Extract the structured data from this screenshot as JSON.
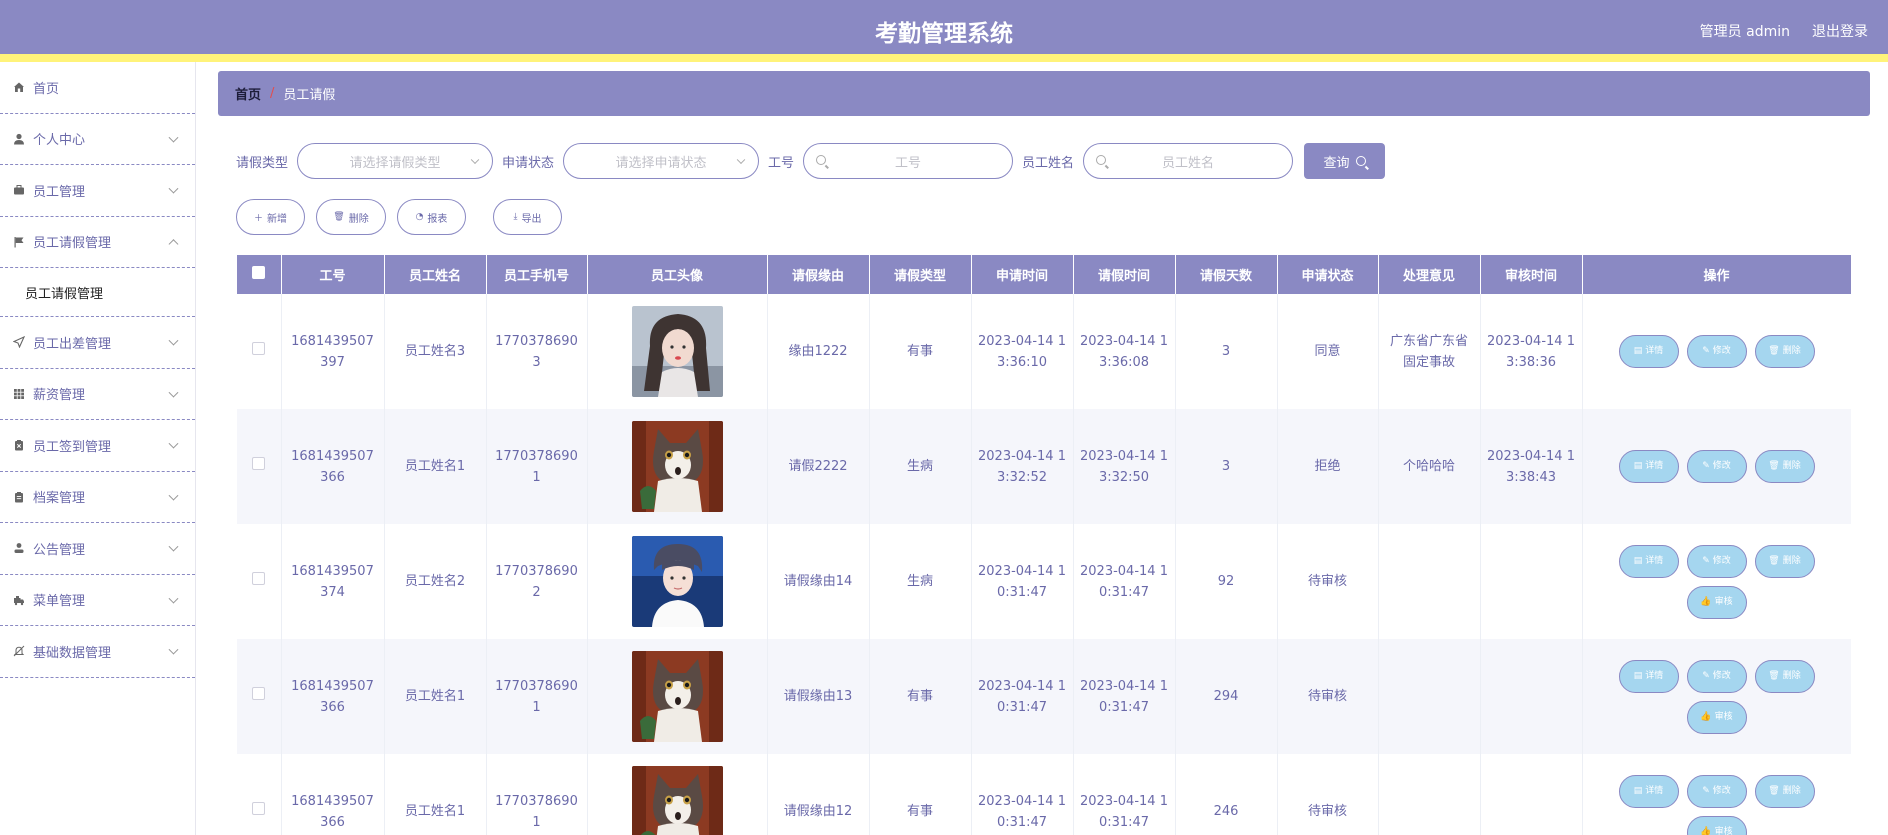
{
  "header": {
    "title": "考勤管理系统",
    "admin_label": "管理员 admin",
    "logout_label": "退出登录"
  },
  "sidebar": {
    "items": [
      {
        "label": "首页",
        "icon": "home-icon"
      },
      {
        "label": "个人中心",
        "icon": "user-icon"
      },
      {
        "label": "员工管理",
        "icon": "briefcase-icon"
      },
      {
        "label": "员工请假管理",
        "icon": "flag-icon",
        "expanded": true
      },
      {
        "label": "员工出差管理",
        "icon": "send-icon"
      },
      {
        "label": "薪资管理",
        "icon": "grid-icon"
      },
      {
        "label": "员工签到管理",
        "icon": "clipboard-x-icon"
      },
      {
        "label": "档案管理",
        "icon": "clipboard-icon"
      },
      {
        "label": "公告管理",
        "icon": "person-icon"
      },
      {
        "label": "菜单管理",
        "icon": "truck-icon"
      },
      {
        "label": "基础数据管理",
        "icon": "bell-off-icon"
      }
    ],
    "submenu_label": "员工请假管理"
  },
  "breadcrumb": {
    "home": "首页",
    "separator": "/",
    "current": "员工请假"
  },
  "search": {
    "leave_type_label": "请假类型",
    "leave_type_placeholder": "请选择请假类型",
    "status_label": "申请状态",
    "status_placeholder": "请选择申请状态",
    "id_label": "工号",
    "id_placeholder": "工号",
    "name_label": "员工姓名",
    "name_placeholder": "员工姓名",
    "query_label": "查询"
  },
  "actions": {
    "add": "新增",
    "delete": "删除",
    "report": "报表",
    "export": "导出"
  },
  "table": {
    "headers": [
      "工号",
      "员工姓名",
      "员工手机号",
      "员工头像",
      "请假缘由",
      "请假类型",
      "申请时间",
      "请假时间",
      "请假天数",
      "申请状态",
      "处理意见",
      "审核时间",
      "操作"
    ],
    "rows": [
      {
        "id": "1681439507397",
        "name": "员工姓名3",
        "phone": "17703786903",
        "avatar": "girl",
        "reason": "缘由1222",
        "type": "有事",
        "apply_time": "2023-04-14 13:36:10",
        "leave_time": "2023-04-14 13:36:08",
        "days": "3",
        "status": "同意",
        "opinion": "广东省广东省固定事故",
        "review_time": "2023-04-14 13:38:36",
        "audit": false
      },
      {
        "id": "1681439507366",
        "name": "员工姓名1",
        "phone": "17703786901",
        "avatar": "cat",
        "reason": "请假2222",
        "type": "生病",
        "apply_time": "2023-04-14 13:32:52",
        "leave_time": "2023-04-14 13:32:50",
        "days": "3",
        "status": "拒绝",
        "opinion": "个哈哈哈",
        "review_time": "2023-04-14 13:38:43",
        "audit": false
      },
      {
        "id": "1681439507374",
        "name": "员工姓名2",
        "phone": "17703786902",
        "avatar": "boy",
        "reason": "请假缘由14",
        "type": "生病",
        "apply_time": "2023-04-14 10:31:47",
        "leave_time": "2023-04-14 10:31:47",
        "days": "92",
        "status": "待审核",
        "opinion": "",
        "review_time": "",
        "audit": true
      },
      {
        "id": "1681439507366",
        "name": "员工姓名1",
        "phone": "17703786901",
        "avatar": "cat",
        "reason": "请假缘由13",
        "type": "有事",
        "apply_time": "2023-04-14 10:31:47",
        "leave_time": "2023-04-14 10:31:47",
        "days": "294",
        "status": "待审核",
        "opinion": "",
        "review_time": "",
        "audit": true
      },
      {
        "id": "1681439507366",
        "name": "员工姓名1",
        "phone": "17703786901",
        "avatar": "cat",
        "reason": "请假缘由12",
        "type": "有事",
        "apply_time": "2023-04-14 10:31:47",
        "leave_time": "2023-04-14 10:31:47",
        "days": "246",
        "status": "待审核",
        "opinion": "",
        "review_time": "",
        "audit": true
      }
    ],
    "op_labels": {
      "detail": "详情",
      "edit": "修改",
      "delete": "删除",
      "audit": "审核"
    }
  },
  "colors": {
    "primary": "#8a89c3",
    "accent_bar": "#fff37a",
    "op_button": "#a5d6ef"
  }
}
